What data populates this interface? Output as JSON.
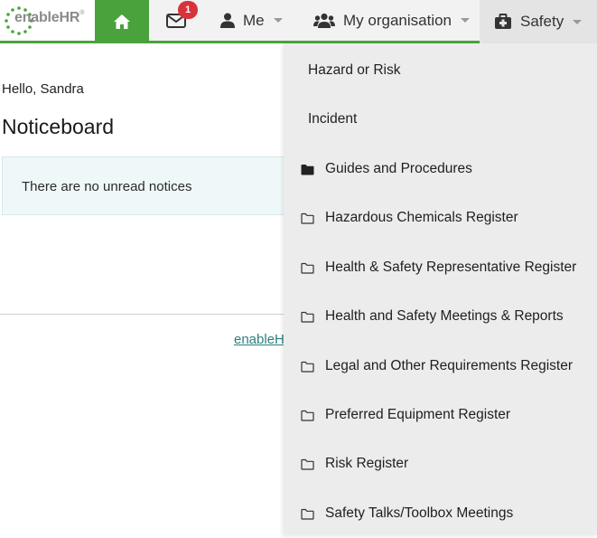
{
  "brand": {
    "logo_text": "enableHR",
    "logo_mark": "®",
    "accent_color": "#4aa23d"
  },
  "nav": {
    "home_icon": "home-icon",
    "mail_icon": "envelope-icon",
    "unread_count": "1",
    "me_label": "Me",
    "org_label": "My organisation",
    "safety_label": "Safety"
  },
  "main": {
    "greeting": "Hello, Sandra",
    "title": "Noticeboard",
    "notice_text": "There are no unread notices",
    "footer_link": "enableHR"
  },
  "safety_menu": {
    "items": [
      {
        "label": "Hazard or Risk",
        "icon": "none"
      },
      {
        "label": "Incident",
        "icon": "none"
      },
      {
        "label": "Guides and Procedures",
        "icon": "folder-filled-icon"
      },
      {
        "label": "Hazardous Chemicals Register",
        "icon": "folder-outline-icon"
      },
      {
        "label": "Health & Safety Representative Register",
        "icon": "folder-outline-icon"
      },
      {
        "label": "Health and Safety Meetings & Reports",
        "icon": "folder-outline-icon"
      },
      {
        "label": "Legal and Other Requirements Register",
        "icon": "folder-outline-icon"
      },
      {
        "label": "Preferred Equipment Register",
        "icon": "folder-outline-icon"
      },
      {
        "label": "Risk Register",
        "icon": "folder-outline-icon"
      },
      {
        "label": "Safety Talks/Toolbox Meetings",
        "icon": "folder-outline-icon"
      }
    ]
  }
}
